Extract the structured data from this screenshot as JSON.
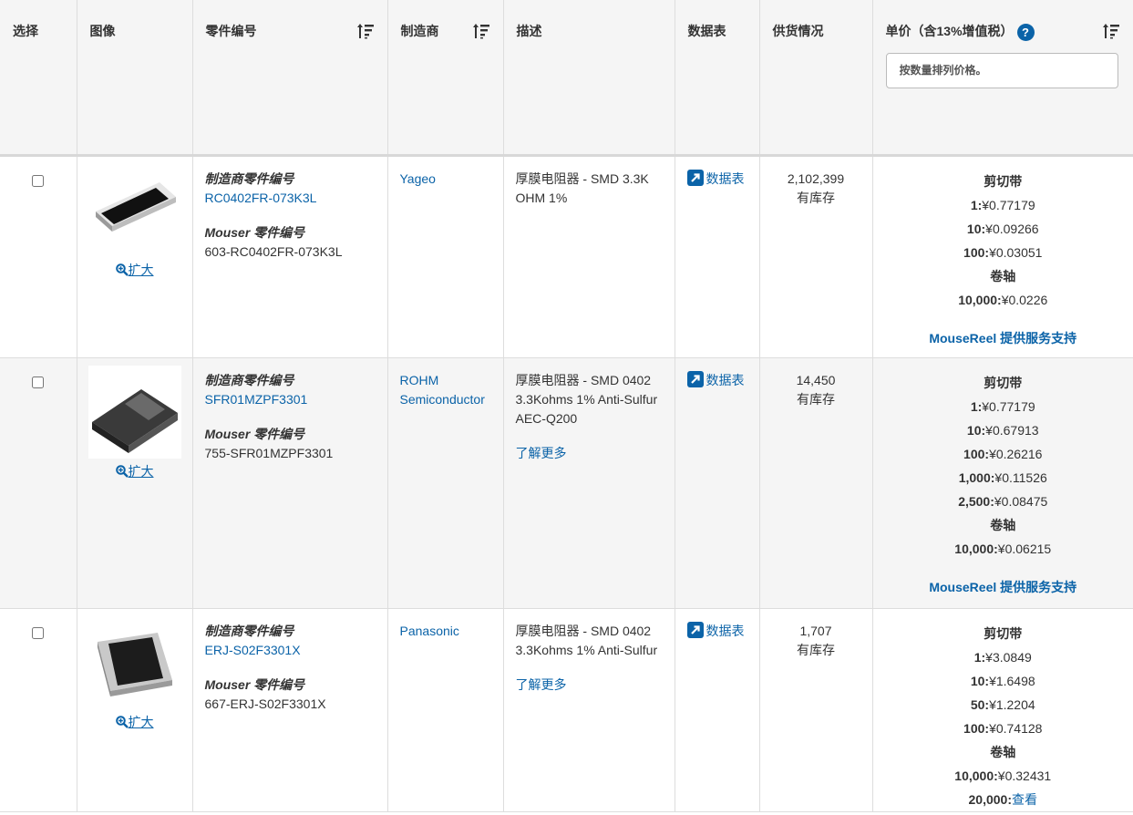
{
  "header": {
    "select": "选择",
    "image": "图像",
    "part_number": "零件编号",
    "manufacturer": "制造商",
    "description": "描述",
    "datasheet": "数据表",
    "availability": "供货情况",
    "unit_price": "单价（含13%增值税）",
    "help": "?",
    "qty_placeholder": "按数量排列价格。"
  },
  "labels": {
    "mfr_part": "制造商零件编号",
    "mouser_part": "Mouser 零件编号",
    "enlarge": "扩大",
    "datasheet_link": "数据表",
    "learn_more": "了解更多",
    "in_stock": "有库存",
    "cut_tape": "剪切带",
    "reel": "卷轴",
    "mousereel": "MouseReel 提供服务支持"
  },
  "rows": [
    {
      "mfr_part_number": "RC0402FR-073K3L",
      "mouser_part_number": "603-RC0402FR-073K3L",
      "manufacturer": "Yageo",
      "description": "厚膜电阻器 - SMD 3.3K OHM 1%",
      "stock": "2,102,399",
      "cut_tape": [
        {
          "qty": "1:",
          "price": "¥0.77179"
        },
        {
          "qty": "10:",
          "price": "¥0.09266"
        },
        {
          "qty": "100:",
          "price": "¥0.03051"
        }
      ],
      "reel": [
        {
          "qty": "10,000:",
          "price": "¥0.0226"
        }
      ]
    },
    {
      "mfr_part_number": "SFR01MZPF3301",
      "mouser_part_number": "755-SFR01MZPF3301",
      "manufacturer": "ROHM Semiconductor",
      "description": "厚膜电阻器 - SMD 0402 3.3Kohms 1% Anti-Sulfur AEC-Q200",
      "stock": "14,450",
      "cut_tape": [
        {
          "qty": "1:",
          "price": "¥0.77179"
        },
        {
          "qty": "10:",
          "price": "¥0.67913"
        },
        {
          "qty": "100:",
          "price": "¥0.26216"
        },
        {
          "qty": "1,000:",
          "price": "¥0.11526"
        },
        {
          "qty": "2,500:",
          "price": "¥0.08475"
        }
      ],
      "reel": [
        {
          "qty": "10,000:",
          "price": "¥0.06215"
        }
      ]
    },
    {
      "mfr_part_number": "ERJ-S02F3301X",
      "mouser_part_number": "667-ERJ-S02F3301X",
      "manufacturer": "Panasonic",
      "description": "厚膜电阻器 - SMD 0402 3.3Kohms 1% Anti-Sulfur",
      "stock": "1,707",
      "cut_tape": [
        {
          "qty": "1:",
          "price": "¥3.0849"
        },
        {
          "qty": "10:",
          "price": "¥1.6498"
        },
        {
          "qty": "50:",
          "price": "¥1.2204"
        },
        {
          "qty": "100:",
          "price": "¥0.74128"
        }
      ],
      "reel": [
        {
          "qty": "10,000:",
          "price": "¥0.32431"
        },
        {
          "qty": "20,000:",
          "price": "查看"
        }
      ]
    }
  ]
}
